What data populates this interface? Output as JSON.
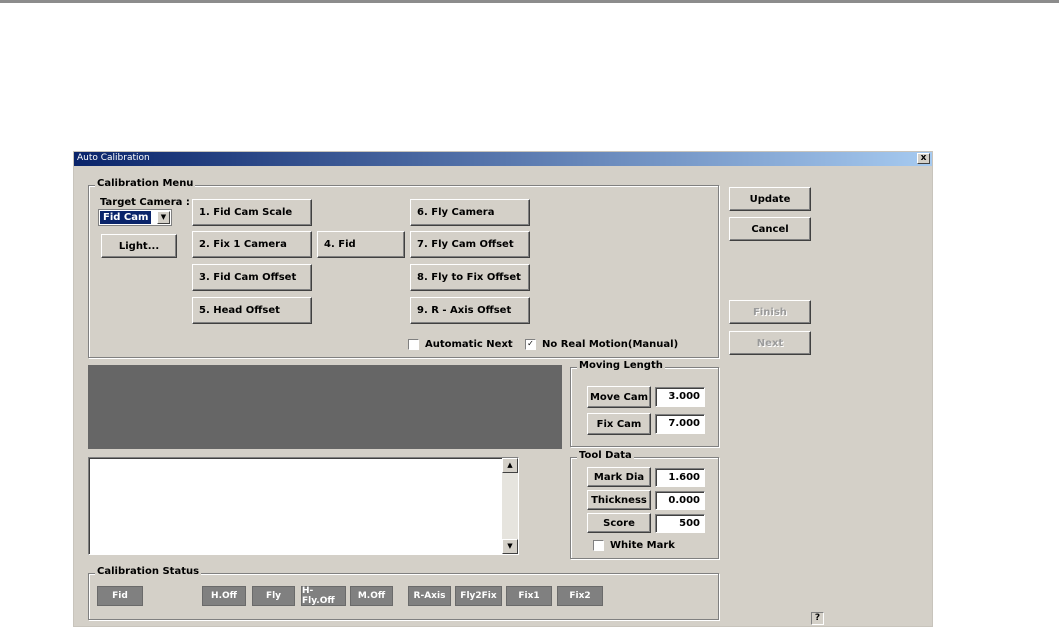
{
  "window": {
    "title": "Auto Calibration",
    "close": "x"
  },
  "menu": {
    "legend": "Calibration Menu",
    "target_camera_label": "Target Camera :",
    "target_camera_value": "Fid Cam",
    "light_button": "Light...",
    "steps": [
      "1. Fid Cam Scale",
      "2. Fix 1 Camera",
      "3. Fid Cam Offset",
      "5. Head Offset",
      "4. Fid",
      "6. Fly Camera",
      "7. Fly Cam Offset",
      "8. Fly to Fix Offset",
      "9. R - Axis Offset"
    ],
    "automatic_next": {
      "label": "Automatic Next",
      "checked": false
    },
    "no_real_motion": {
      "label": "No Real Motion(Manual)",
      "checked": true
    }
  },
  "side_buttons": {
    "update": "Update",
    "cancel": "Cancel",
    "finish": "Finish",
    "next": "Next"
  },
  "moving_length": {
    "legend": "Moving Length",
    "move_cam_label": "Move Cam",
    "move_cam_value": "3.000",
    "fix_cam_label": "Fix Cam",
    "fix_cam_value": "7.000"
  },
  "tool_data": {
    "legend": "Tool Data",
    "mark_dia_label": "Mark Dia",
    "mark_dia_value": "1.600",
    "thickness_label": "Thickness",
    "thickness_value": "0.000",
    "score_label": "Score",
    "score_value": "500",
    "white_mark": {
      "label": "White Mark",
      "checked": false
    }
  },
  "status": {
    "legend": "Calibration Status",
    "items": [
      "Fid",
      "H.Off",
      "Fly",
      "H-Fly.Off",
      "M.Off",
      "R-Axis",
      "Fly2Fix",
      "Fix1",
      "Fix2"
    ]
  },
  "help_icon": "?"
}
